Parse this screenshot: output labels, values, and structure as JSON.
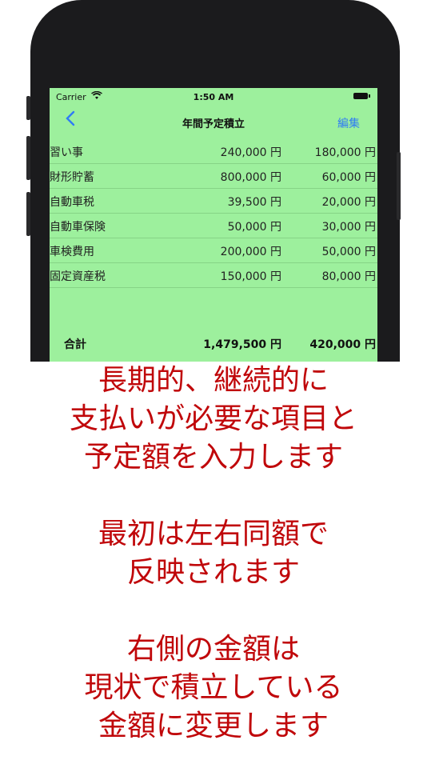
{
  "status": {
    "carrier": "Carrier",
    "time": "1:50 AM"
  },
  "nav": {
    "back": "<",
    "title": "年間予定積立",
    "edit": "編集"
  },
  "rows": [
    {
      "name": "習い事",
      "v1": "240,000 円",
      "v2": "180,000 円"
    },
    {
      "name": "財形貯蓄",
      "v1": "800,000 円",
      "v2": "60,000 円"
    },
    {
      "name": "自動車税",
      "v1": "39,500 円",
      "v2": "20,000 円"
    },
    {
      "name": "自動車保険",
      "v1": "50,000 円",
      "v2": "30,000 円"
    },
    {
      "name": "車検費用",
      "v1": "200,000 円",
      "v2": "50,000 円"
    },
    {
      "name": "固定資産税",
      "v1": "150,000 円",
      "v2": "80,000 円"
    }
  ],
  "total": {
    "label": "合計",
    "v1": "1,479,500 円",
    "v2": "420,000 円"
  },
  "caption": {
    "block1": [
      "長期的、継続的に",
      "支払いが必要な項目と",
      "予定額を入力します"
    ],
    "block2": [
      "最初は左右同額で",
      "反映されます"
    ],
    "block3": [
      "右側の金額は",
      "現状で積立している",
      "金額に変更します"
    ]
  },
  "colors": {
    "screen_bg": "#9df09d",
    "accent": "#2f7bf5",
    "caption": "#c0070a"
  }
}
